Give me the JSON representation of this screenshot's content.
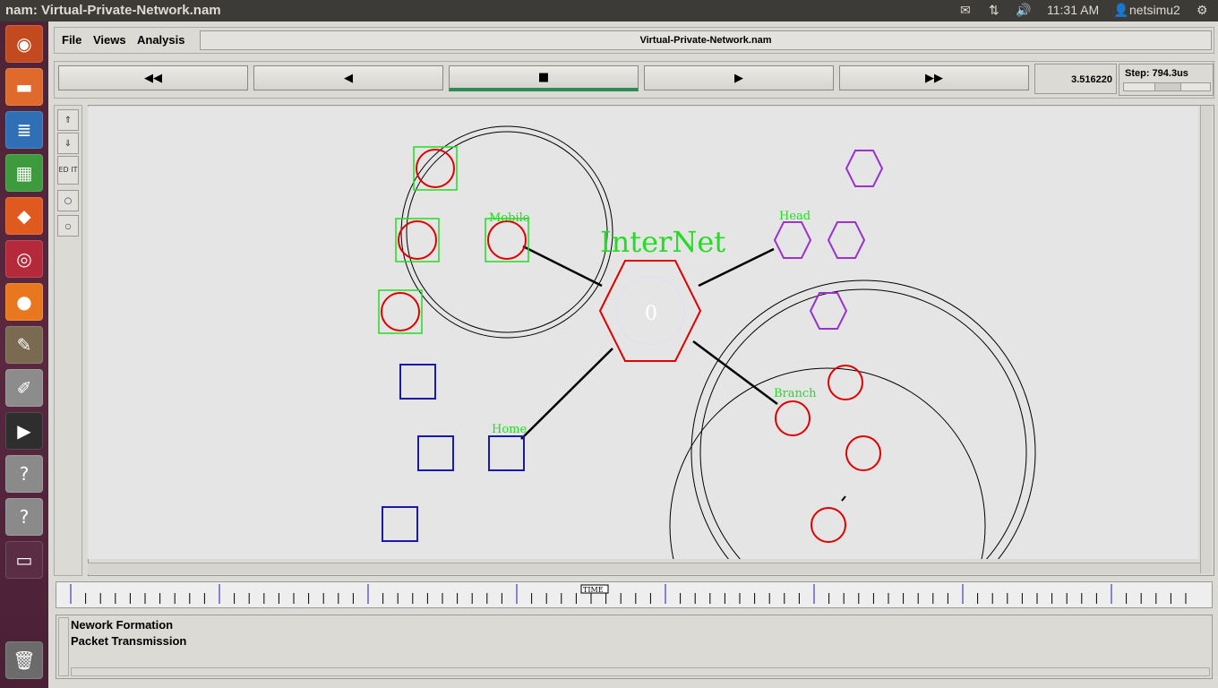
{
  "topbar": {
    "window_title": "nam: Virtual-Private-Network.nam",
    "clock": "11:31 AM",
    "user": "netsimu2"
  },
  "launcher": {
    "items": [
      {
        "name": "ubuntu-dash-icon",
        "glyph": "◉",
        "color": "#c24a1e"
      },
      {
        "name": "files-icon",
        "glyph": "▬",
        "color": "#e06a2c"
      },
      {
        "name": "writer-icon",
        "glyph": "≣",
        "color": "#2f6fb5"
      },
      {
        "name": "calc-icon",
        "glyph": "▦",
        "color": "#3d9b3d"
      },
      {
        "name": "software-center-icon",
        "glyph": "◆",
        "color": "#e05a20"
      },
      {
        "name": "aptana-icon",
        "glyph": "◎",
        "color": "#b52a3a"
      },
      {
        "name": "firefox-icon",
        "glyph": "●",
        "color": "#e8771d"
      },
      {
        "name": "gimp-icon",
        "glyph": "✎",
        "color": "#7a6a52"
      },
      {
        "name": "text-editor-icon",
        "glyph": "✐",
        "color": "#8c8c8c"
      },
      {
        "name": "terminal-icon",
        "glyph": "▶",
        "color": "#2e2e2e"
      },
      {
        "name": "unknown-app-icon",
        "glyph": "?",
        "color": "#8a8a8a"
      },
      {
        "name": "unknown-app-icon",
        "glyph": "?",
        "color": "#8a8a8a"
      },
      {
        "name": "workspace-switcher-icon",
        "glyph": "▭",
        "color": "#5a2d45"
      },
      {
        "name": "trash-icon",
        "glyph": "🗑",
        "color": "#6b6b6b"
      }
    ]
  },
  "menubar": {
    "file": "File",
    "views": "Views",
    "analysis": "Analysis",
    "filename": "Virtual-Private-Network.nam"
  },
  "controls": {
    "rewind": "◀◀",
    "back": "◀",
    "stop": "■",
    "play": "▶",
    "fast_forward": "▶▶",
    "time": "3.516220",
    "step": "Step: 794.3us"
  },
  "tools": {
    "edit": "ED IT"
  },
  "canvas_labels": {
    "internet": "InterNet",
    "internet_node_id": "0",
    "mobile": "Mobile",
    "head": "Head",
    "branch": "Branch",
    "home": "Home"
  },
  "timeline": {
    "label": "TIME"
  },
  "annotations": {
    "lines": [
      "Nework Formation",
      "Packet Transmission"
    ]
  },
  "colors": {
    "node_red": "#e00000",
    "box_green": "#22dd22",
    "hex_purple": "#9933cc",
    "box_blue": "#1a1aaa",
    "label_green": "#22dd22"
  }
}
